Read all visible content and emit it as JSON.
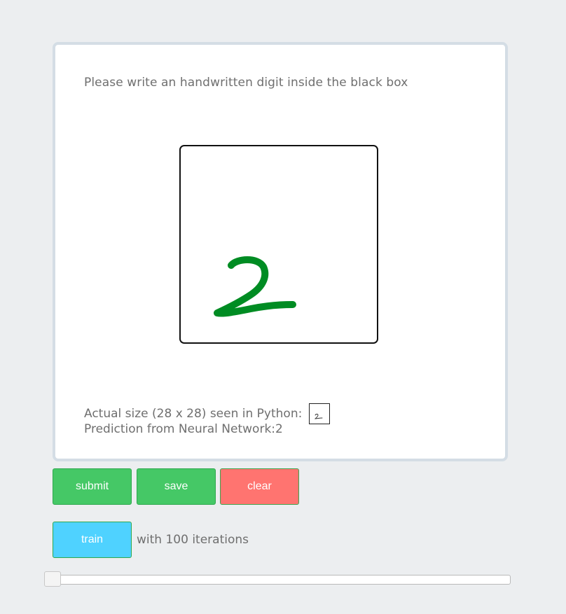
{
  "instruction": "Please write an handwritten digit inside the black box",
  "drawing": {
    "digit": "2",
    "stroke_color": "#008c23"
  },
  "preview": {
    "label": "Actual size (28 x 28) seen in Python:",
    "thumbnail_digit": "2"
  },
  "prediction": {
    "label": "Prediction from Neural Network:",
    "value": "2"
  },
  "buttons": {
    "submit": "submit",
    "save": "save",
    "clear": "clear",
    "train": "train"
  },
  "training": {
    "iterations_text": "with 100 iterations",
    "slider_value": 0
  },
  "colors": {
    "green_button": "#45c866",
    "red_button": "#ff7470",
    "blue_button": "#4fd2ff",
    "background": "#eceef0"
  }
}
